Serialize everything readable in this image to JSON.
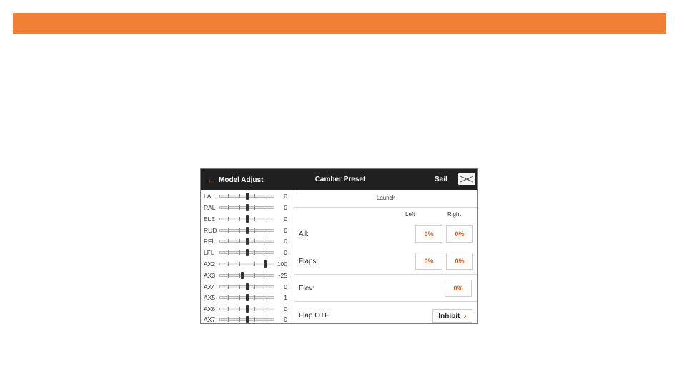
{
  "header": {
    "back_label": "Model Adjust",
    "title": "Camber Preset",
    "mode": "Sail"
  },
  "channels": [
    {
      "name": "LAL",
      "value": "0",
      "level": 0
    },
    {
      "name": "RAL",
      "value": "0",
      "level": 0
    },
    {
      "name": "ELE",
      "value": "0",
      "level": 0
    },
    {
      "name": "RUD",
      "value": "0",
      "level": 0
    },
    {
      "name": "RFL",
      "value": "0",
      "level": 0
    },
    {
      "name": "LFL",
      "value": "0",
      "level": 0
    },
    {
      "name": "AX2",
      "value": "100",
      "level": 100
    },
    {
      "name": "AX3",
      "value": "-25",
      "level": -25
    },
    {
      "name": "AX4",
      "value": "0",
      "level": 0
    },
    {
      "name": "AX5",
      "value": "1",
      "level": 1
    },
    {
      "name": "AX6",
      "value": "0",
      "level": 0
    },
    {
      "name": "AX7",
      "value": "0",
      "level": 0
    }
  ],
  "preset": {
    "section": "Launch",
    "col_left": "Left",
    "col_right": "Right",
    "ail_label": "Ail:",
    "ail_left": "0%",
    "ail_right": "0%",
    "flaps_label": "Flaps:",
    "flaps_left": "0%",
    "flaps_right": "0%",
    "elev_label": "Elev:",
    "elev_value": "0%",
    "flap_otf_label": "Flap OTF",
    "flap_otf_value": "Inhibit"
  },
  "colors": {
    "accent": "#f28034",
    "value_text": "#d4621f",
    "titlebar": "#202020"
  },
  "icons": {
    "back": "left-arrow-icon",
    "model": "glider-icon",
    "chevron": "chevron-right-icon"
  }
}
